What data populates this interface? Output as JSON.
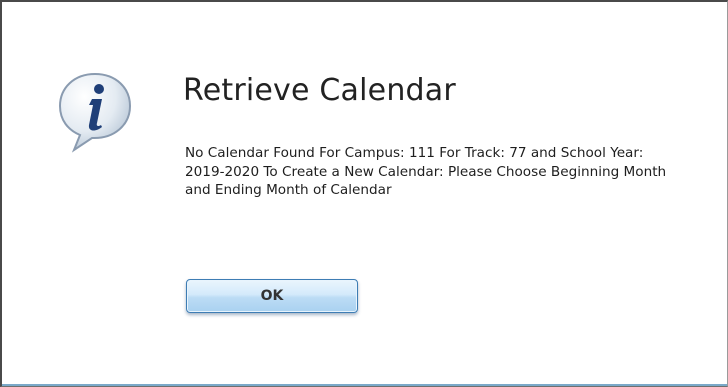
{
  "dialog": {
    "title": "Retrieve Calendar",
    "icon": "info-icon",
    "message": "No Calendar Found For Campus: 111 For Track: 77 and School Year: 2019-2020 To Create a New Calendar: Please Choose Beginning Month and Ending Month of Calendar",
    "ok_label": "OK"
  },
  "colors": {
    "button_border": "#3e7db4",
    "button_fill": "#bcdcf5",
    "icon_bubble": "#dde6ef",
    "icon_glyph": "#1f3f78"
  }
}
